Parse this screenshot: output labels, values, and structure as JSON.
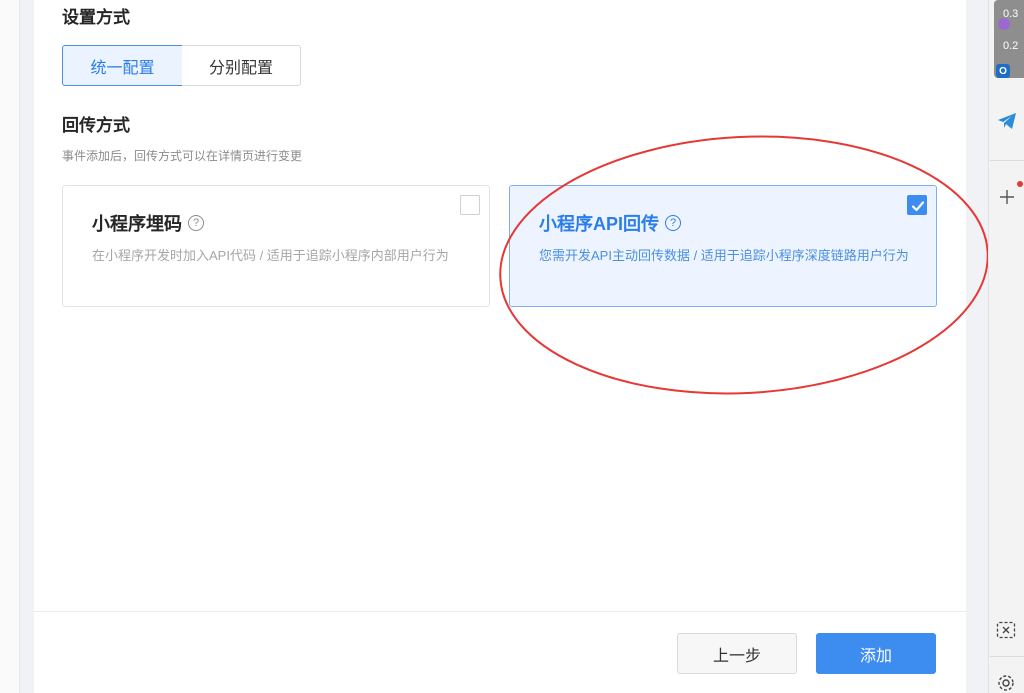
{
  "config": {
    "section_title": "设置方式",
    "tabs": [
      {
        "label": "统一配置",
        "selected": true
      },
      {
        "label": "分别配置",
        "selected": false
      }
    ]
  },
  "callback": {
    "section_title": "回传方式",
    "hint": "事件添加后，回传方式可以在详情页进行变更",
    "options": [
      {
        "title": "小程序埋码",
        "description": "在小程序开发时加入API代码 / 适用于追踪小程序内部用户行为",
        "checked": false
      },
      {
        "title": "小程序API回传",
        "description": "您需开发API主动回传数据 / 适用于追踪小程序深度链路用户行为",
        "checked": true
      }
    ]
  },
  "footer": {
    "prev_label": "上一步",
    "add_label": "添加"
  },
  "sidebar": {
    "net_speed_1": "0.3",
    "net_speed_2": "0.2",
    "outlook_letter": "O",
    "icons": [
      "network-monitor-icon",
      "outlook-icon",
      "telegram-icon",
      "add-icon",
      "screenshot-icon",
      "settings-icon"
    ]
  },
  "colors": {
    "accent": "#3d8cf0",
    "selected_bg": "#edf4ff",
    "annotation": "#e53935"
  }
}
